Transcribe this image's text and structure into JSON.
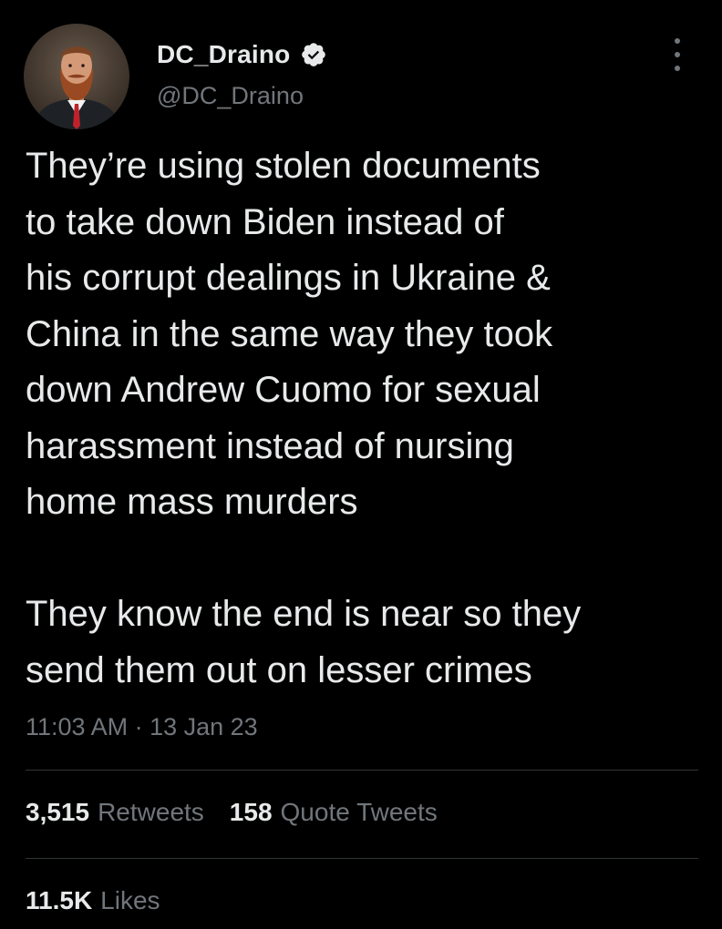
{
  "author": {
    "display_name": "DC_Draino",
    "handle": "@DC_Draino",
    "verified": true,
    "verified_color": "#e7e9ea"
  },
  "tweet": {
    "text": "They’re using stolen documents\nto take down Biden instead of\nhis corrupt dealings in Ukraine &\nChina in the same way they took\ndown Andrew Cuomo for sexual\nharassment instead of nursing\nhome mass murders\n\nThey know the end is near so they\nsend them out on lesser crimes",
    "timestamp": "11:03 AM · 13 Jan 23"
  },
  "stats": {
    "retweets": {
      "count": "3,515",
      "label": "Retweets"
    },
    "quote_tweets": {
      "count": "158",
      "label": "Quote Tweets"
    },
    "likes": {
      "count": "11.5K",
      "label": "Likes"
    }
  },
  "icons": {
    "verified": "verified-badge-icon",
    "more": "more-vertical-icon"
  },
  "colors": {
    "background": "#000000",
    "primary_text": "#e7e9ea",
    "secondary_text": "#71767b",
    "divider": "#2f3336"
  }
}
